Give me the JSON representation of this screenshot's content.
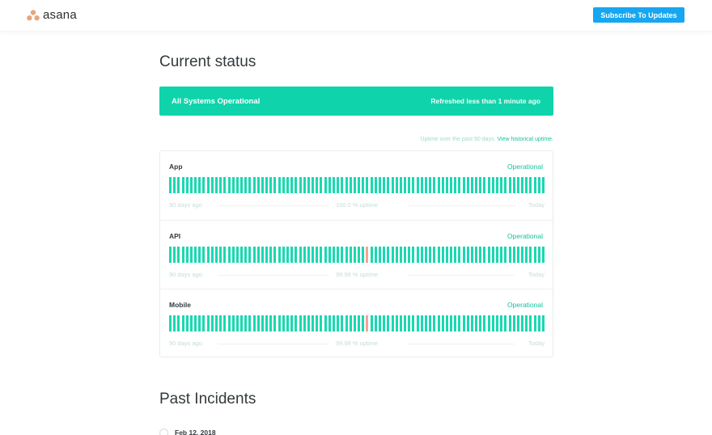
{
  "header": {
    "logo_text": "asana",
    "subscribe_label": "Subscribe To Updates",
    "accent_color": "#17a6f0"
  },
  "current_status": {
    "title": "Current status",
    "banner_text": "All Systems Operational",
    "refreshed_text": "Refreshed less than 1 minute ago",
    "banner_color": "#0fd4ab"
  },
  "uptime_note": {
    "text": "Uptime over the past 90 days.",
    "link": "View historical uptime."
  },
  "components": [
    {
      "name": "App",
      "status": "Operational",
      "days_ago": "90 days ago",
      "uptime": "100.0 % uptime",
      "today": "Today",
      "incident_days": []
    },
    {
      "name": "API",
      "status": "Operational",
      "days_ago": "90 days ago",
      "uptime": "99.99 % uptime",
      "today": "Today",
      "incident_days": [
        47
      ]
    },
    {
      "name": "Mobile",
      "status": "Operational",
      "days_ago": "90 days ago",
      "uptime": "99.98 % uptime",
      "today": "Today",
      "incident_days": [
        47
      ]
    }
  ],
  "uptime_bar": {
    "days": 90,
    "ok_color": "#1ad8b1",
    "incident_color": "#f4a591"
  },
  "past_incidents": {
    "title": "Past Incidents",
    "first_date": "Feb 12, 2018"
  }
}
